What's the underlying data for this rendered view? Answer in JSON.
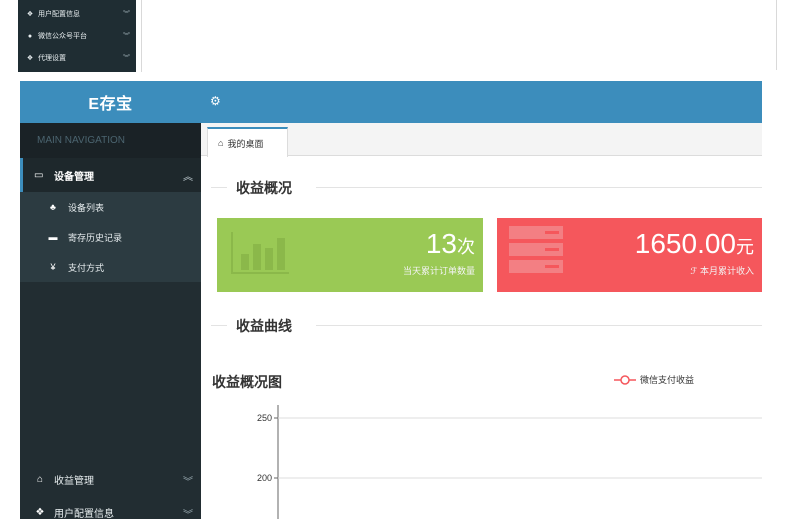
{
  "mini_sidebar": {
    "items": [
      {
        "icon": "users-icon",
        "glyph": "❖",
        "label": "用户配置信息"
      },
      {
        "icon": "wechat-icon",
        "glyph": "●",
        "label": "微信公众号平台"
      },
      {
        "icon": "agent-icon",
        "glyph": "❖",
        "label": "代理设置"
      }
    ]
  },
  "brand": {
    "title": "E存宝"
  },
  "sidebar": {
    "header": "MAIN NAVIGATION",
    "active": {
      "icon": "monitor-icon",
      "glyph": "▭",
      "label": "设备管理"
    },
    "submenu": [
      {
        "icon": "sitemap-icon",
        "glyph": "♣",
        "label": "设备列表"
      },
      {
        "icon": "history-icon",
        "glyph": "▬",
        "label": "寄存历史记录"
      },
      {
        "icon": "yen-icon",
        "glyph": "¥",
        "label": "支付方式"
      }
    ],
    "bottom": [
      {
        "icon": "bank-icon",
        "glyph": "⌂",
        "label": "收益管理"
      },
      {
        "icon": "users-icon",
        "glyph": "❖",
        "label": "用户配置信息"
      }
    ]
  },
  "topbar": {
    "icon": "gears-icon",
    "glyph": "⚙"
  },
  "tabs": [
    {
      "icon": "home-icon",
      "glyph": "⌂",
      "label": "我的桌面"
    }
  ],
  "sections": {
    "overview": "收益概况",
    "curve": "收益曲线"
  },
  "cards": {
    "orders": {
      "value": "13",
      "unit": "次",
      "label": "当天累计订单数量",
      "color": "#9ac955"
    },
    "income": {
      "value": "1650.00",
      "unit": "元",
      "label": "本月累计收入",
      "color": "#f5575c"
    }
  },
  "chart_data": {
    "type": "line",
    "title": "收益概况图",
    "series": [
      {
        "name": "微信支付收益",
        "values": []
      }
    ],
    "yticks": [
      250,
      200
    ],
    "legend": "top-right",
    "grid": true
  }
}
